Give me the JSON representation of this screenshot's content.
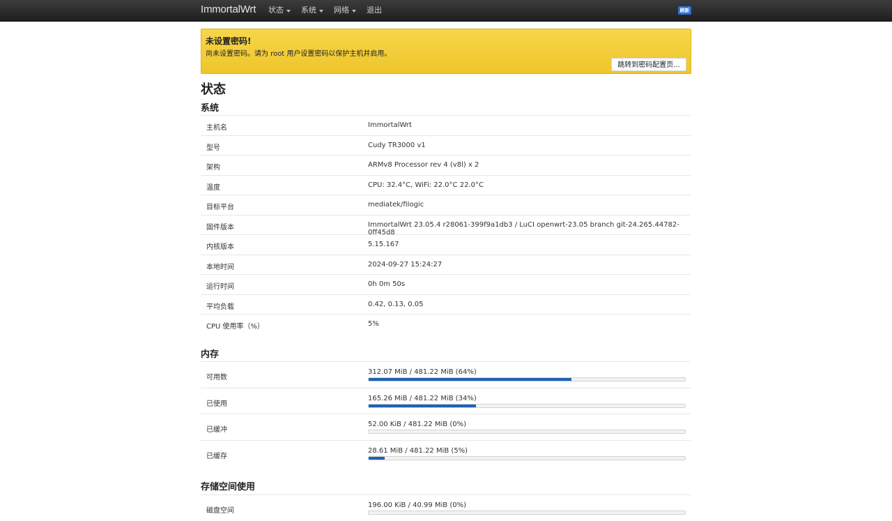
{
  "navbar": {
    "brand": "ImmortalWrt",
    "menu": [
      {
        "label": "状态",
        "dropdown": true
      },
      {
        "label": "系统",
        "dropdown": true
      },
      {
        "label": "网络",
        "dropdown": true
      },
      {
        "label": "退出",
        "dropdown": false
      }
    ],
    "refresh_label": "刷新"
  },
  "alert": {
    "title": "未设置密码!",
    "text": "尚未设置密码。请为 root 用户设置密码以保护主机并启用。",
    "button": "跳转到密码配置页..."
  },
  "page_title": "状态",
  "system": {
    "title": "系统",
    "rows": [
      {
        "label": "主机名",
        "value": "ImmortalWrt"
      },
      {
        "label": "型号",
        "value": "Cudy TR3000 v1"
      },
      {
        "label": "架构",
        "value": "ARMv8 Processor rev 4 (v8l) x 2"
      },
      {
        "label": "温度",
        "value": "CPU: 32.4°C, WiFi: 22.0°C 22.0°C"
      },
      {
        "label": "目标平台",
        "value": "mediatek/filogic"
      },
      {
        "label": "固件版本",
        "value": "ImmortalWrt 23.05.4 r28061-399f9a1db3 / LuCI openwrt-23.05 branch git-24.265.44782-0ff45d8"
      },
      {
        "label": "内核版本",
        "value": "5.15.167"
      },
      {
        "label": "本地时间",
        "value": "2024-09-27 15:24:27"
      },
      {
        "label": "运行时间",
        "value": "0h 0m 50s"
      },
      {
        "label": "平均负载",
        "value": "0.42, 0.13, 0.05"
      },
      {
        "label": "CPU 使用率（%）",
        "value": "5%"
      }
    ]
  },
  "memory": {
    "title": "内存",
    "rows": [
      {
        "label": "可用数",
        "text": "312.07 MiB / 481.22 MiB (64%)",
        "percent": 64
      },
      {
        "label": "已使用",
        "text": "165.26 MiB / 481.22 MiB (34%)",
        "percent": 34
      },
      {
        "label": "已缓冲",
        "text": "52.00 KiB / 481.22 MiB (0%)",
        "percent": 0
      },
      {
        "label": "已缓存",
        "text": "28.61 MiB / 481.22 MiB (5%)",
        "percent": 5
      }
    ]
  },
  "storage": {
    "title": "存储空间使用",
    "rows": [
      {
        "label": "磁盘空间",
        "text": "196.00 KiB / 40.99 MiB (0%)",
        "percent": 0
      }
    ]
  }
}
